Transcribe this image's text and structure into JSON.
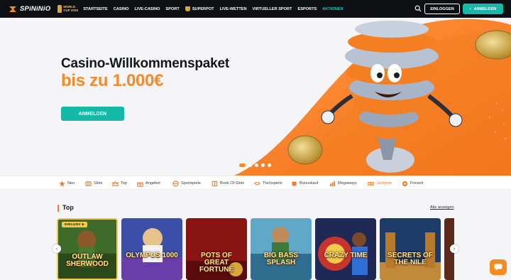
{
  "brand": {
    "name": "SPiNiNiO",
    "badge_text": "WORLD CUP 2026"
  },
  "nav": {
    "items": [
      {
        "label": "STARTSEITE"
      },
      {
        "label": "CASINO"
      },
      {
        "label": "LIVE-CASINO"
      },
      {
        "label": "SPORT"
      },
      {
        "label": "SUPERPOT",
        "icon": "trophy-icon"
      },
      {
        "label": "LIVE-WETTEN"
      },
      {
        "label": "VIRTUELLER SPORT"
      },
      {
        "label": "ESPORTS"
      },
      {
        "label": "AKTIONEN",
        "active": true
      }
    ],
    "login_label": "EINLOGGEN",
    "register_label": "ANMELDEN"
  },
  "hero": {
    "title": "Casino-Willkommenspaket",
    "subtitle": "bis zu 1.000€",
    "cta_label": "ANMELDEN",
    "slides_total": 5,
    "slide_active": 1
  },
  "categories": [
    {
      "label": "Neu",
      "icon": "star-icon"
    },
    {
      "label": "Slots",
      "icon": "slot-machine-icon"
    },
    {
      "label": "Top",
      "icon": "crown-icon"
    },
    {
      "label": "Angebot",
      "icon": "gift-icon"
    },
    {
      "label": "Sportspiele",
      "icon": "ball-icon"
    },
    {
      "label": "Book Of Slots",
      "icon": "book-icon"
    },
    {
      "label": "Tischspiele",
      "icon": "table-icon"
    },
    {
      "label": "Bonuskauf",
      "icon": "clover-icon"
    },
    {
      "label": "Megaways",
      "icon": "megaways-icon"
    },
    {
      "label": "Jackpots",
      "icon": "jackpot-icon",
      "active": true
    },
    {
      "label": "Freizeit",
      "icon": "leisure-icon"
    }
  ],
  "top_section": {
    "title": "Top",
    "all_link": "Alle anzeigen",
    "games": [
      {
        "name": "OUTLAW SHERWOOD",
        "badge": "EXKLUSIV ★"
      },
      {
        "name": "OLYMPUS 1000"
      },
      {
        "name": "POTS OF GREAT FORTUNE"
      },
      {
        "name": "BIG BASS SPLASH"
      },
      {
        "name": "CRAZY TIME"
      },
      {
        "name": "SECRETS OF THE NILE"
      }
    ]
  },
  "colors": {
    "accent": "#16b8a8",
    "brand_orange": "#f68a2a",
    "nav_bg": "#0f1014"
  }
}
